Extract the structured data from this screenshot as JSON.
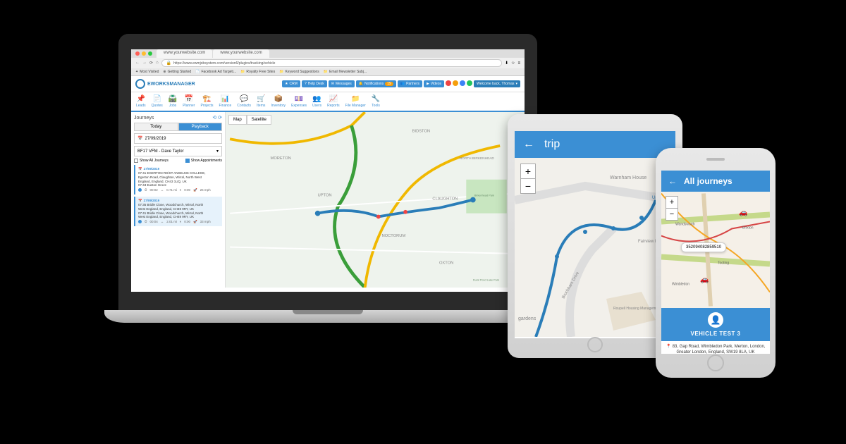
{
  "browser": {
    "tab1": "www.yourwebsite.com",
    "tab2": "www.yourwebsite.com",
    "url": "https://www.ewmjobsystem.com/version6/plugins/tracking/vehicle",
    "bookmarks": [
      "Most Visited",
      "Getting Started",
      "Facebook Ad Targeti...",
      "Royalty Free Sites",
      "Keyword Suggestions",
      "Email Newsletter Subj..."
    ]
  },
  "app": {
    "logo_text": "EWORKSMANAGER",
    "header_chips": {
      "crm": "CRM",
      "helpdesk": "Help Desk",
      "messages": "Messages",
      "notifications": "Notifications",
      "notifications_count": "19",
      "partners": "Partners",
      "videos": "Videos",
      "welcome": "Welcome back, Thomas"
    },
    "toolbar": [
      "Leads",
      "Quotes",
      "Jobs",
      "Planner",
      "Projects",
      "Finance",
      "Contacts",
      "Items",
      "Inventory",
      "Expenses",
      "Users",
      "Reports",
      "File Manager",
      "Tools"
    ],
    "toolbar_icons": [
      "📌",
      "📄",
      "🛣️",
      "📅",
      "🏗️",
      "📊",
      "💬",
      "🛒",
      "📦",
      "💷",
      "👥",
      "📈",
      "📁",
      "🔧"
    ]
  },
  "sidebar": {
    "title": "Journeys",
    "tabs": {
      "today": "Today",
      "playback": "Playback"
    },
    "date": "27/09/2019",
    "vehicle": "BF17 VFM - Dave Taylor",
    "check1": "Show All Journeys",
    "check2": "Show Appointments",
    "journeys": [
      {
        "date": "27/09/2019",
        "line1": "07:41 EGERTON RD/ST ANSELMS COLLEGE,",
        "line2": "Egerton Road, Claughton, Wirral, North West",
        "line3": "England, England, CH43 1UQ, UK",
        "line4": "07:43 Euston Grove",
        "time": "00:02",
        "dist": "0.71 mi",
        "idle": "0:00",
        "max": "26 mph"
      },
      {
        "date": "27/09/2019",
        "line1": "07:35 Bridle Close, Woodchurch, Wirral, North",
        "line2": "West England, England, CH49 9RY, UK",
        "line3": "07:41 Bridle Close, Woodchurch, Wirral, North",
        "line4": "West England, England, CH49 9RY, UK",
        "time": "00:04",
        "dist": "2.01 mi",
        "idle": "0:00",
        "max": "33 mph"
      }
    ]
  },
  "map": {
    "btn_map": "Map",
    "btn_sat": "Satellite",
    "labels": [
      "MORETON",
      "UPTON",
      "BIDSTON",
      "NORTH BIRKENHEAD",
      "CLAUGHTON",
      "NOCTORUM",
      "OXTON",
      "Birkenhead Park",
      "Duck Pond Lake Park"
    ]
  },
  "tablet": {
    "title": "trip",
    "map_labels": [
      "Warnham House",
      "Upper Tulse",
      "Fairview Place",
      "Brockham Drive",
      "gardens",
      "Roupell Housing Management"
    ]
  },
  "phone": {
    "title": "All journeys",
    "marker_id": "352094082859510",
    "map_labels": [
      "Wandsworth",
      "Brixton",
      "Tooting",
      "Wimbledon"
    ],
    "vehicle": "VEHICLE TEST 3",
    "address": "83, Gap Road, Wimbledon Park, Merton, London, Greater London, England, SW19 8LA, UK"
  }
}
